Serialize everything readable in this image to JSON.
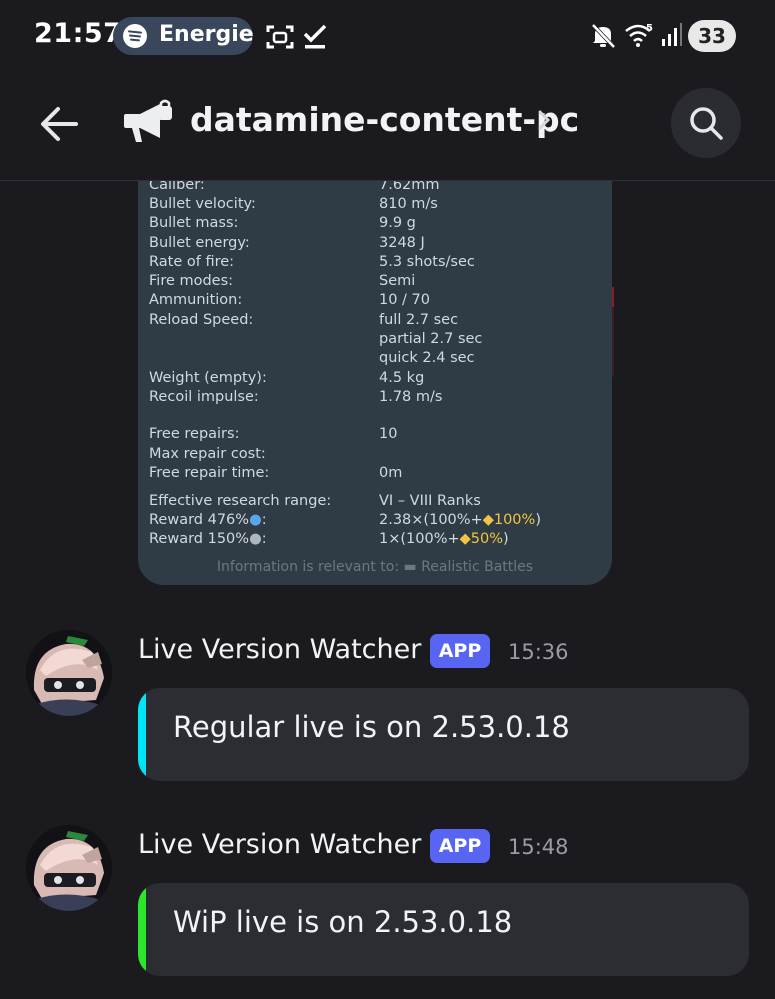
{
  "status": {
    "time": "21:57",
    "media_label": "Energie",
    "wifi_badge": "5",
    "battery": "33"
  },
  "header": {
    "channel": "datamine-content-pc"
  },
  "stats": {
    "rows": [
      {
        "label": "Caliber:",
        "value": "7.62mm"
      },
      {
        "label": "Bullet velocity:",
        "value": "810 m/s"
      },
      {
        "label": "Bullet mass:",
        "value": "9.9 g"
      },
      {
        "label": "Bullet energy:",
        "value": "3248 J"
      },
      {
        "label": "Rate of fire:",
        "value": "5.3 shots/sec"
      },
      {
        "label": "Fire modes:",
        "value": "Semi"
      },
      {
        "label": "Ammunition:",
        "value": "10 / 70"
      },
      {
        "label": "Reload Speed:",
        "value": "full 2.7 sec"
      },
      {
        "label": "",
        "value": "partial 2.7 sec"
      },
      {
        "label": "",
        "value": "quick 2.4 sec"
      },
      {
        "label": "Weight (empty):",
        "value": "4.5 kg"
      },
      {
        "label": "Recoil impulse:",
        "value": "1.78 m/s"
      },
      {
        "label": "Free repairs:",
        "value": "10"
      },
      {
        "label": "Max repair cost:",
        "value": ""
      },
      {
        "label": "Free repair time:",
        "value": "0m"
      },
      {
        "label": "Effective research range:",
        "value": "VI – VIII Ranks"
      }
    ],
    "reward1": {
      "label": "Reward",
      "pct": "476%",
      "value_prefix": "2.38×(100%+",
      "value_gold": "100%",
      "value_suffix": ")"
    },
    "reward2": {
      "label": "Reward",
      "pct": "150%",
      "value_prefix": "1×(100%+",
      "value_gold": "50%",
      "value_suffix": ")"
    },
    "footer": "Information is relevant to:",
    "footer_mode": "Realistic Battles"
  },
  "messages": [
    {
      "author": "Live Version Watcher",
      "badge": "APP",
      "time": "15:36",
      "text": "Regular live is on 2.53.0.18",
      "bar_color": "#00e5f5"
    },
    {
      "author": "Live Version Watcher",
      "badge": "APP",
      "time": "15:48",
      "text": "WiP live is on 2.53.0.18",
      "bar_color": "#2be62b"
    }
  ],
  "colors": {
    "background": "#1b1b1f",
    "embed": "#2b2d33",
    "badge": "#5865f2",
    "card": "#2f3b45"
  },
  "icons": [
    "spotify-icon",
    "screenshot-icon",
    "check-icon",
    "mute-icon",
    "wifi-icon",
    "signal-icon",
    "back-arrow-icon",
    "announcement-megaphone-icon",
    "chevron-right-icon",
    "search-icon"
  ]
}
